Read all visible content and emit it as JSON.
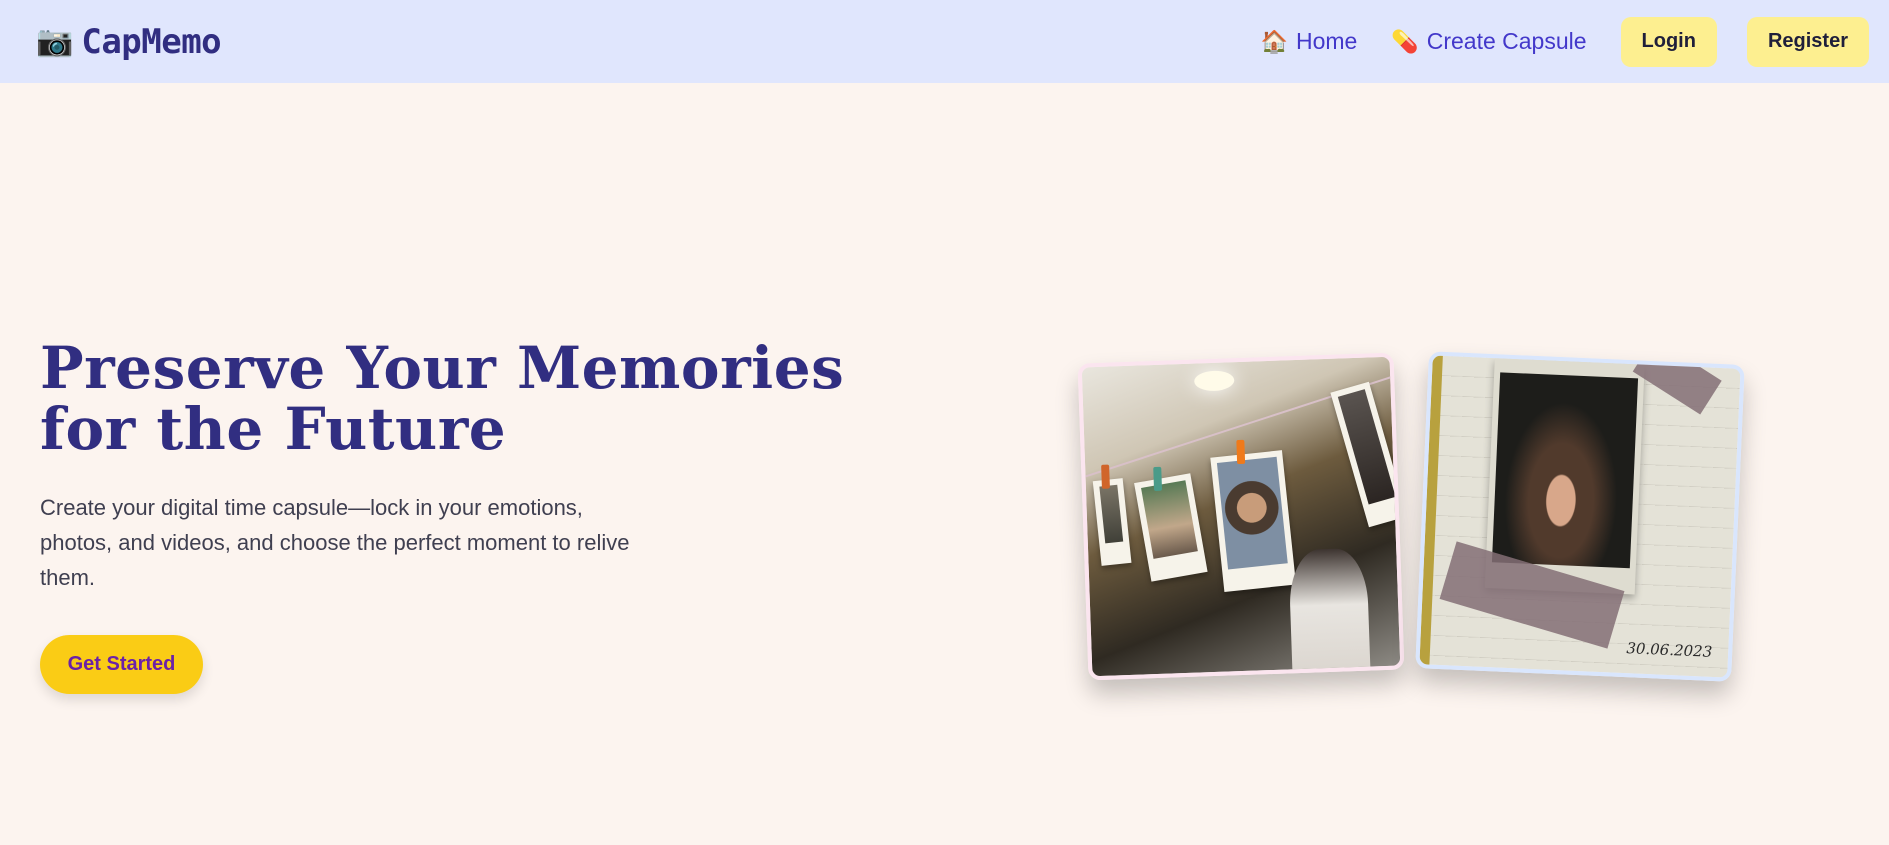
{
  "navbar": {
    "brand_icon": "📷",
    "brand_name": "CapMemo",
    "links": [
      {
        "icon": "🏠",
        "icon_name": "home-icon",
        "label": "Home"
      },
      {
        "icon": "💊",
        "icon_name": "capsule-icon",
        "label": "Create Capsule"
      }
    ],
    "login_label": "Login",
    "register_label": "Register"
  },
  "hero": {
    "title": "Preserve Your Memories for the Future",
    "subtitle": "Create your digital time capsule—lock in your emotions, photos, and videos, and choose the perfect moment to relive them.",
    "cta_label": "Get Started"
  },
  "gallery": {
    "photo2_date": "30.06.2023"
  },
  "colors": {
    "navbar_bg": "#e0e6fd",
    "page_bg": "#fcf4ef",
    "primary_text": "#312e81",
    "link_color": "#4338ca",
    "auth_button_bg": "#fdef90",
    "cta_bg": "#facc15",
    "cta_text": "#6b21a8"
  }
}
